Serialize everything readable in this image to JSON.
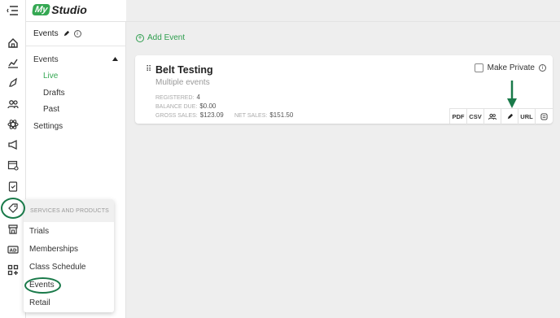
{
  "app": {
    "logo_badge": "My",
    "logo_text": "Studio"
  },
  "sidebar": {
    "header_title": "Events",
    "items": [
      {
        "label": "Events"
      },
      {
        "label": "Live"
      },
      {
        "label": "Drafts"
      },
      {
        "label": "Past"
      },
      {
        "label": "Settings"
      }
    ]
  },
  "main": {
    "add_event_label": "Add Event"
  },
  "event_card": {
    "title": "Belt Testing",
    "subtitle": "Multiple events",
    "registered_label": "REGISTERED:",
    "registered_value": "4",
    "balance_label": "BALANCE DUE:",
    "balance_value": "$0.00",
    "gross_label": "GROSS SALES:",
    "gross_value": "$123.09",
    "net_label": "NET SALES:",
    "net_value": "$151.50",
    "make_private_label": "Make Private",
    "actions": {
      "pdf": "PDF",
      "csv": "CSV",
      "url": "URL"
    }
  },
  "services_popup": {
    "header": "SERVICES AND PRODUCTS",
    "items": [
      {
        "label": "Trials"
      },
      {
        "label": "Memberships"
      },
      {
        "label": "Class Schedule"
      },
      {
        "label": "Events"
      },
      {
        "label": "Retail"
      }
    ]
  },
  "colors": {
    "brand_green": "#35a853",
    "annotation_green": "#1a7a4a"
  }
}
